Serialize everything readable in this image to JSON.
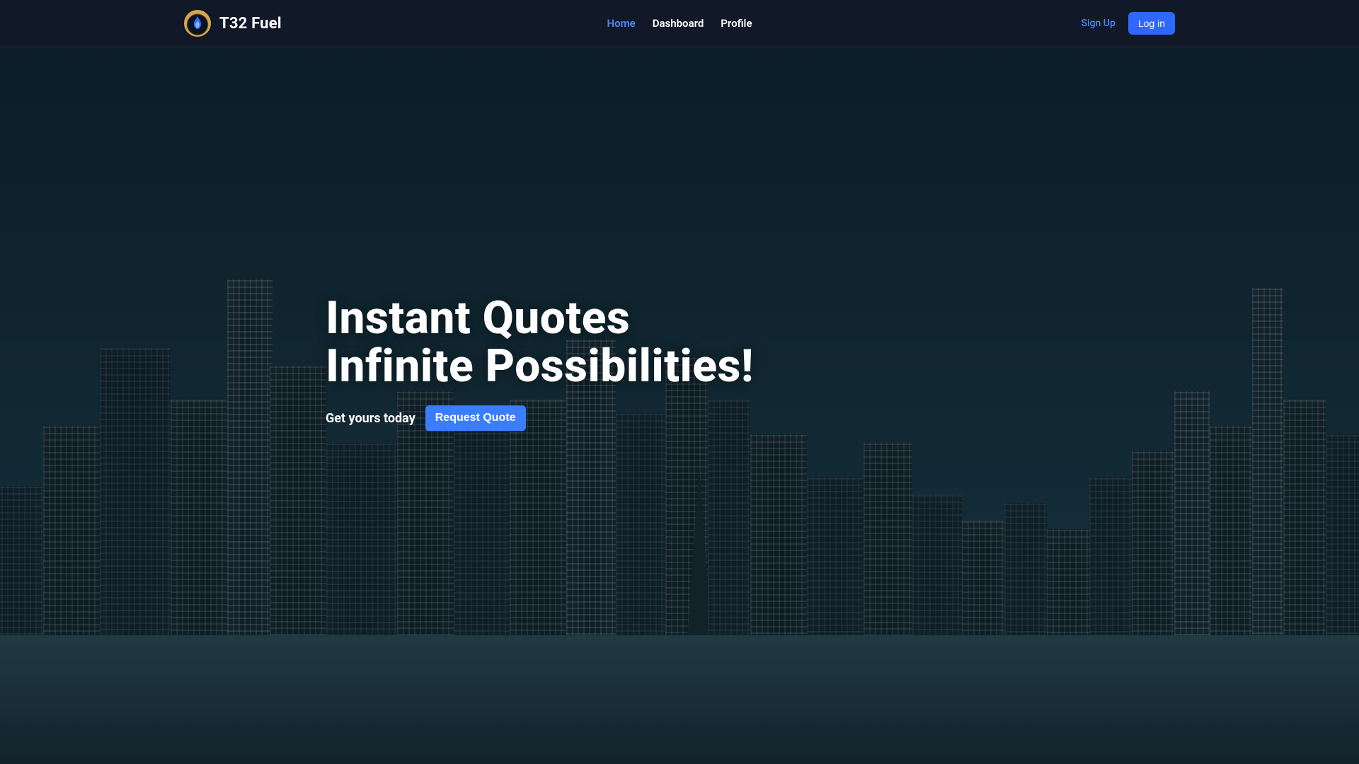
{
  "brand": {
    "name": "T32 Fuel",
    "logo_icon": "flame-icon"
  },
  "nav": {
    "items": [
      {
        "label": "Home",
        "active": true
      },
      {
        "label": "Dashboard",
        "active": false
      },
      {
        "label": "Profile",
        "active": false
      }
    ]
  },
  "auth": {
    "signup_label": "Sign Up",
    "login_label": "Log in"
  },
  "hero": {
    "headline_line1": "Instant Quotes",
    "headline_line2": "Infinite Possibilities!",
    "subtext": "Get yours today",
    "cta_label": "Request Quote"
  },
  "colors": {
    "accent": "#2f68ff",
    "accent_text": "#4a88ff",
    "nav_bg": "#111827"
  }
}
